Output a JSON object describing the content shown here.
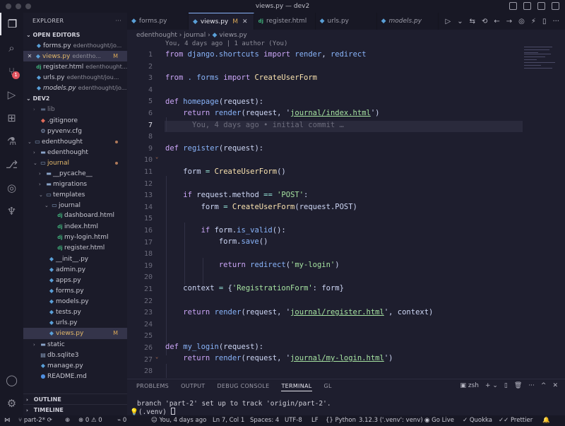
{
  "window": {
    "title": "views.py — dev2"
  },
  "sidebar": {
    "title": "EXPLORER",
    "open_editors": {
      "label": "OPEN EDITORS",
      "items": [
        {
          "name": "forms.py",
          "desc": "edenthought/jo..."
        },
        {
          "name": "views.py",
          "desc": "edentho...",
          "mark": "M"
        },
        {
          "name": "register.html",
          "desc": "edenthought..."
        },
        {
          "name": "urls.py",
          "desc": "edenthought/jou..."
        },
        {
          "name": "models.py",
          "desc": "edenthought/jo..."
        }
      ]
    },
    "workspace": {
      "label": "DEV2",
      "items": [
        {
          "name": "lib"
        },
        {
          "name": ".gitignore"
        },
        {
          "name": "pyvenv.cfg"
        },
        {
          "name": "edenthought"
        },
        {
          "name": "edenthought"
        },
        {
          "name": "journal"
        },
        {
          "name": "__pycache__"
        },
        {
          "name": "migrations"
        },
        {
          "name": "templates"
        },
        {
          "name": "journal"
        },
        {
          "name": "dashboard.html"
        },
        {
          "name": "index.html"
        },
        {
          "name": "my-login.html"
        },
        {
          "name": "register.html"
        },
        {
          "name": "__init__.py"
        },
        {
          "name": "admin.py"
        },
        {
          "name": "apps.py"
        },
        {
          "name": "forms.py"
        },
        {
          "name": "models.py"
        },
        {
          "name": "tests.py"
        },
        {
          "name": "urls.py"
        },
        {
          "name": "views.py",
          "mark": "M"
        },
        {
          "name": "static"
        },
        {
          "name": "db.sqlite3"
        },
        {
          "name": "manage.py"
        },
        {
          "name": "README.md"
        }
      ]
    },
    "outline": "OUTLINE",
    "timeline": "TIMELINE"
  },
  "tabs": [
    {
      "label": "forms.py"
    },
    {
      "label": "views.py",
      "mark": "M"
    },
    {
      "label": "register.html"
    },
    {
      "label": "urls.py"
    },
    {
      "label": "models.py"
    }
  ],
  "breadcrumb": {
    "a": "edenthought",
    "b": "journal",
    "c": "views.py"
  },
  "editor": {
    "blame_header": "You, 4 days ago | 1 author (You)",
    "line_numbers": [
      "1",
      "2",
      "3",
      "4",
      "5",
      "6",
      "7",
      "8",
      "9",
      "10",
      "11",
      "12",
      "13",
      "14",
      "15",
      "16",
      "17",
      "18",
      "19",
      "20",
      "21",
      "22",
      "23",
      "24",
      "25",
      "26",
      "27",
      "28"
    ],
    "inline_blame": "You, 4 days ago • initial commit …",
    "code": {
      "l1": {
        "a": "from",
        "b": "django.shortcuts",
        "c": "import",
        "d": "render",
        "e": ",",
        "f": "redirect"
      },
      "l3": {
        "a": "from",
        "b": ". forms",
        "c": "import",
        "d": "CreateUserForm"
      },
      "l5": {
        "a": "def",
        "b": "homepage",
        "c": "(request):"
      },
      "l6": {
        "a": "return",
        "b": "render",
        "c": "(request, '",
        "d": "journal/index.html",
        "e": "')"
      },
      "l9": {
        "a": "def",
        "b": "register",
        "c": "(request):"
      },
      "l11": {
        "a": "form",
        "b": "=",
        "c": "CreateUserForm",
        "d": "()"
      },
      "l13": {
        "a": "if",
        "b": "request.method",
        "c": "==",
        "d": "'POST'",
        "e": ":"
      },
      "l14": {
        "a": "form",
        "b": "=",
        "c": "CreateUserForm",
        "d": "(request.POST)"
      },
      "l16": {
        "a": "if",
        "b": "form.",
        "c": "is_valid",
        "d": "():"
      },
      "l17": {
        "a": "form.",
        "b": "save",
        "c": "()"
      },
      "l19": {
        "a": "return",
        "b": "redirect",
        "c": "(",
        "d": "'my-login'",
        "e": ")"
      },
      "l21": {
        "a": "context",
        "b": "=",
        "c": "{",
        "d": "'RegistrationForm'",
        "e": ": form",
        "f": "}"
      },
      "l23": {
        "a": "return",
        "b": "render",
        "c": "(request, '",
        "d": "journal/register.html",
        "e": "', context)"
      },
      "l26": {
        "a": "def",
        "b": "my_login",
        "c": "(request):"
      },
      "l27": {
        "a": "return",
        "b": "render",
        "c": "(request, '",
        "d": "journal/my-login.html",
        "e": "')"
      }
    }
  },
  "panel": {
    "tabs": [
      "PROBLEMS",
      "OUTPUT",
      "DEBUG CONSOLE",
      "TERMINAL",
      "GL"
    ],
    "active_tab": "TERMINAL",
    "shell": "zsh",
    "line1": "branch 'part-2' set up to track 'origin/part-2'.",
    "line2": "(.venv) "
  },
  "status": {
    "branch": "part-2*",
    "problems": "0 ⚠ 0",
    "ports": "0",
    "blame": "You, 4 days ago",
    "position": "Ln 7, Col 1",
    "spaces": "Spaces: 4",
    "encoding": "UTF-8",
    "eol": "LF",
    "language": "Python",
    "interpreter": "3.12.3 ('.venv': venv)",
    "golive": "Go Live",
    "quokka": "Quokka",
    "prettier": "Prettier"
  },
  "colors": {
    "accent": "#89b4fa",
    "modified": "#d8a657",
    "badge": "#e0535f"
  }
}
